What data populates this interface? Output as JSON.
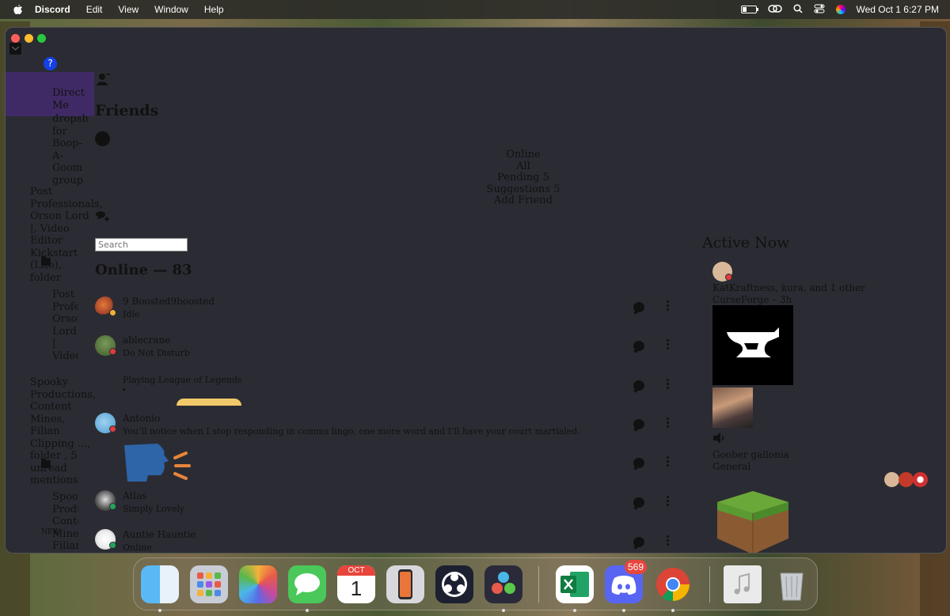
{
  "menubar": {
    "app": "Discord",
    "items": [
      "Edit",
      "View",
      "Window",
      "Help"
    ],
    "datetime": "Wed Oct 1  6:27 PM"
  },
  "window": {
    "title": "Friends"
  },
  "sidebar": {
    "help_badge": "?",
    "direct_messages": "Direct Me",
    "group_dm": "dropsh for Boop-A-Goom group",
    "folder1_name": "Post Professionals, Orson Lord |, Video Editor Kickstart (Lite), folder",
    "folder1_items": "Post Profes Orson Lord | Video Editor",
    "folder2_name": "Spooky Productions, Content Mines, Filian Clipping ..., folder , 5 unread mentions",
    "folder2_items": "Spook Produ Conte Mines Filian",
    "new_badge": "NEW",
    "overflow_mark": "o:"
  },
  "header": {
    "title": "Friends",
    "tabs": [
      "Online",
      "All",
      "Pending   5",
      "Suggestions   5",
      "Add Friend"
    ]
  },
  "search": {
    "placeholder": "Search"
  },
  "friends_list": {
    "heading": "Online — 83",
    "rows": [
      {
        "name": "9 Boosted9boosted",
        "status": "Idle",
        "presence": "idle"
      },
      {
        "name": "ablecrane",
        "status": "Do Not Disturb",
        "presence": "dnd"
      },
      {
        "name": "",
        "status": "Playing League of Legends",
        "presence": "none"
      },
      {
        "name": "Antonio",
        "status": "You’ll notice when I stop responding in comms lingo, one more word and I’ll have your court martialed.",
        "presence": "dnd"
      },
      {
        "name": "",
        "status": "",
        "presence": "none"
      },
      {
        "name": "Atlas",
        "status": "Simply Lovely",
        "presence": "online"
      },
      {
        "name": "Auntie Hauntie",
        "status": "Online",
        "presence": "online"
      }
    ]
  },
  "active_now": {
    "heading": "Active Now",
    "card1_people": "KatKraftness, kura, and 1 other",
    "card1_activity": "CurseForge – 3h",
    "card2_user": "Goober gallonia",
    "card2_channel": "General"
  },
  "dock": {
    "discord_badge": "569",
    "calendar_month": "OCT",
    "calendar_day": "1"
  },
  "colors": {
    "window_bg": "#2b2c33",
    "dnd": "#e03c3c",
    "online": "#23a55a",
    "idle": "#f0b232",
    "dm_highlight": "#4a2a7a"
  }
}
